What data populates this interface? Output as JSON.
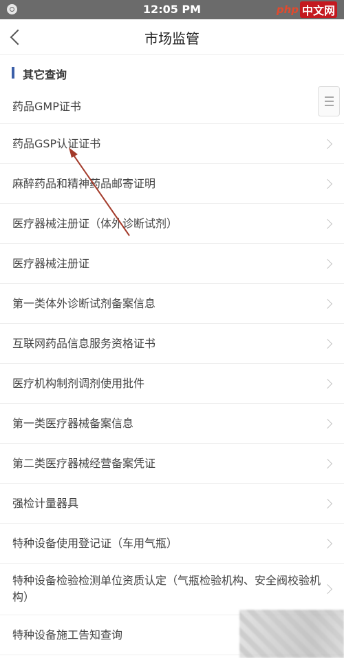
{
  "status_bar": {
    "time": "12:05 PM",
    "logo_php": "php",
    "logo_cn": "中文网"
  },
  "nav": {
    "title": "市场监管"
  },
  "section": {
    "title": "其它查询"
  },
  "items": [
    {
      "label": "药品GMP证书"
    },
    {
      "label": "药品GSP认证证书"
    },
    {
      "label": "麻醉药品和精神药品邮寄证明"
    },
    {
      "label": "医疗器械注册证（体外诊断试剂）"
    },
    {
      "label": "医疗器械注册证"
    },
    {
      "label": "第一类体外诊断试剂备案信息"
    },
    {
      "label": "互联网药品信息服务资格证书"
    },
    {
      "label": "医疗机构制剂调剂使用批件"
    },
    {
      "label": "第一类医疗器械备案信息"
    },
    {
      "label": "第二类医疗器械经营备案凭证"
    },
    {
      "label": "强检计量器具"
    },
    {
      "label": "特种设备使用登记证（车用气瓶）"
    },
    {
      "label": "特种设备检验检测单位资质认定（气瓶检验机构、安全阀校验机构）"
    },
    {
      "label": "特种设备施工告知查询"
    }
  ],
  "colors": {
    "status_bar": "#6b6b6b",
    "section_accent": "#3b5fa8",
    "annotation_arrow": "#a33a2a"
  }
}
